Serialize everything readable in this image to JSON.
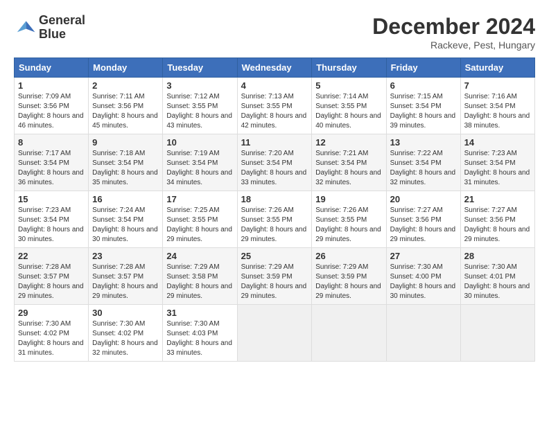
{
  "header": {
    "logo_line1": "General",
    "logo_line2": "Blue",
    "month_year": "December 2024",
    "location": "Rackeve, Pest, Hungary"
  },
  "weekdays": [
    "Sunday",
    "Monday",
    "Tuesday",
    "Wednesday",
    "Thursday",
    "Friday",
    "Saturday"
  ],
  "weeks": [
    [
      {
        "day": "1",
        "sunrise": "7:09 AM",
        "sunset": "3:56 PM",
        "daylight": "8 hours and 46 minutes."
      },
      {
        "day": "2",
        "sunrise": "7:11 AM",
        "sunset": "3:56 PM",
        "daylight": "8 hours and 45 minutes."
      },
      {
        "day": "3",
        "sunrise": "7:12 AM",
        "sunset": "3:55 PM",
        "daylight": "8 hours and 43 minutes."
      },
      {
        "day": "4",
        "sunrise": "7:13 AM",
        "sunset": "3:55 PM",
        "daylight": "8 hours and 42 minutes."
      },
      {
        "day": "5",
        "sunrise": "7:14 AM",
        "sunset": "3:55 PM",
        "daylight": "8 hours and 40 minutes."
      },
      {
        "day": "6",
        "sunrise": "7:15 AM",
        "sunset": "3:54 PM",
        "daylight": "8 hours and 39 minutes."
      },
      {
        "day": "7",
        "sunrise": "7:16 AM",
        "sunset": "3:54 PM",
        "daylight": "8 hours and 38 minutes."
      }
    ],
    [
      {
        "day": "8",
        "sunrise": "7:17 AM",
        "sunset": "3:54 PM",
        "daylight": "8 hours and 36 minutes."
      },
      {
        "day": "9",
        "sunrise": "7:18 AM",
        "sunset": "3:54 PM",
        "daylight": "8 hours and 35 minutes."
      },
      {
        "day": "10",
        "sunrise": "7:19 AM",
        "sunset": "3:54 PM",
        "daylight": "8 hours and 34 minutes."
      },
      {
        "day": "11",
        "sunrise": "7:20 AM",
        "sunset": "3:54 PM",
        "daylight": "8 hours and 33 minutes."
      },
      {
        "day": "12",
        "sunrise": "7:21 AM",
        "sunset": "3:54 PM",
        "daylight": "8 hours and 32 minutes."
      },
      {
        "day": "13",
        "sunrise": "7:22 AM",
        "sunset": "3:54 PM",
        "daylight": "8 hours and 32 minutes."
      },
      {
        "day": "14",
        "sunrise": "7:23 AM",
        "sunset": "3:54 PM",
        "daylight": "8 hours and 31 minutes."
      }
    ],
    [
      {
        "day": "15",
        "sunrise": "7:23 AM",
        "sunset": "3:54 PM",
        "daylight": "8 hours and 30 minutes."
      },
      {
        "day": "16",
        "sunrise": "7:24 AM",
        "sunset": "3:54 PM",
        "daylight": "8 hours and 30 minutes."
      },
      {
        "day": "17",
        "sunrise": "7:25 AM",
        "sunset": "3:55 PM",
        "daylight": "8 hours and 29 minutes."
      },
      {
        "day": "18",
        "sunrise": "7:26 AM",
        "sunset": "3:55 PM",
        "daylight": "8 hours and 29 minutes."
      },
      {
        "day": "19",
        "sunrise": "7:26 AM",
        "sunset": "3:55 PM",
        "daylight": "8 hours and 29 minutes."
      },
      {
        "day": "20",
        "sunrise": "7:27 AM",
        "sunset": "3:56 PM",
        "daylight": "8 hours and 29 minutes."
      },
      {
        "day": "21",
        "sunrise": "7:27 AM",
        "sunset": "3:56 PM",
        "daylight": "8 hours and 29 minutes."
      }
    ],
    [
      {
        "day": "22",
        "sunrise": "7:28 AM",
        "sunset": "3:57 PM",
        "daylight": "8 hours and 29 minutes."
      },
      {
        "day": "23",
        "sunrise": "7:28 AM",
        "sunset": "3:57 PM",
        "daylight": "8 hours and 29 minutes."
      },
      {
        "day": "24",
        "sunrise": "7:29 AM",
        "sunset": "3:58 PM",
        "daylight": "8 hours and 29 minutes."
      },
      {
        "day": "25",
        "sunrise": "7:29 AM",
        "sunset": "3:59 PM",
        "daylight": "8 hours and 29 minutes."
      },
      {
        "day": "26",
        "sunrise": "7:29 AM",
        "sunset": "3:59 PM",
        "daylight": "8 hours and 29 minutes."
      },
      {
        "day": "27",
        "sunrise": "7:30 AM",
        "sunset": "4:00 PM",
        "daylight": "8 hours and 30 minutes."
      },
      {
        "day": "28",
        "sunrise": "7:30 AM",
        "sunset": "4:01 PM",
        "daylight": "8 hours and 30 minutes."
      }
    ],
    [
      {
        "day": "29",
        "sunrise": "7:30 AM",
        "sunset": "4:02 PM",
        "daylight": "8 hours and 31 minutes."
      },
      {
        "day": "30",
        "sunrise": "7:30 AM",
        "sunset": "4:02 PM",
        "daylight": "8 hours and 32 minutes."
      },
      {
        "day": "31",
        "sunrise": "7:30 AM",
        "sunset": "4:03 PM",
        "daylight": "8 hours and 33 minutes."
      },
      null,
      null,
      null,
      null
    ]
  ]
}
